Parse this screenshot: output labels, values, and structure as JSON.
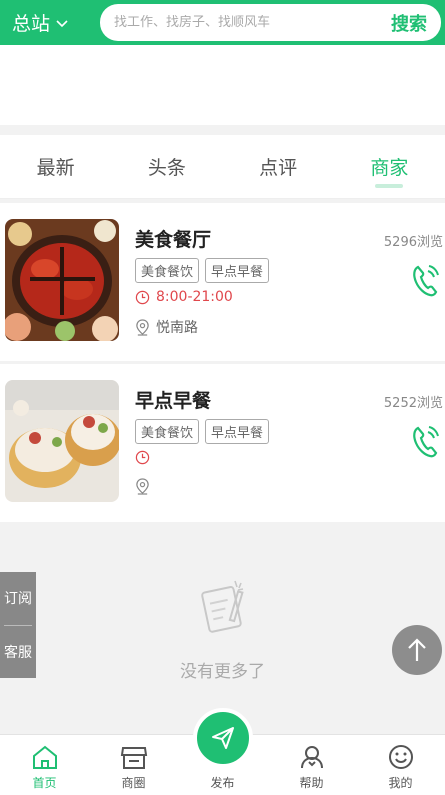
{
  "header": {
    "city": "总站",
    "search_placeholder": "找工作、找房子、找顺风车",
    "search_button": "搜索"
  },
  "tabs": [
    {
      "label": "最新",
      "active": false
    },
    {
      "label": "头条",
      "active": false
    },
    {
      "label": "点评",
      "active": false
    },
    {
      "label": "商家",
      "active": true
    }
  ],
  "listings": [
    {
      "title": "美食餐厅",
      "views": "5296浏览",
      "tags": [
        "美食餐饮",
        "早点早餐"
      ],
      "hours": "8:00-21:00",
      "address": "悦南路"
    },
    {
      "title": "早点早餐",
      "views": "5252浏览",
      "tags": [
        "美食餐饮",
        "早点早餐"
      ],
      "hours": "",
      "address": ""
    }
  ],
  "empty_text": "没有更多了",
  "side_float": {
    "subscribe": "订阅",
    "service": "客服"
  },
  "bottom_nav": [
    {
      "label": "首页",
      "icon": "home-icon",
      "active": true
    },
    {
      "label": "商圈",
      "icon": "shop-icon",
      "active": false
    },
    {
      "label": "发布",
      "icon": "send-icon",
      "active": false
    },
    {
      "label": "帮助",
      "icon": "help-icon",
      "active": false
    },
    {
      "label": "我的",
      "icon": "smile-icon",
      "active": false
    }
  ],
  "colors": {
    "accent": "#1fbf73",
    "hours": "#e0474c"
  }
}
